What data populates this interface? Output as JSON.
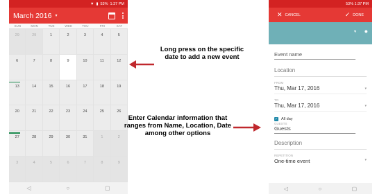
{
  "left_phone": {
    "status": {
      "battery": "53%",
      "time": "1:37 PM"
    },
    "app_bar": {
      "title": "March 2016",
      "caret": "▾"
    },
    "weekdays": [
      "SUN",
      "MON",
      "TUE",
      "WED",
      "THU",
      "FRI",
      "SAT"
    ],
    "weeks": [
      [
        "29",
        "29",
        "1",
        "2",
        "3",
        "4",
        "5"
      ],
      [
        "6",
        "7",
        "8",
        "9",
        "10",
        "11",
        "12"
      ],
      [
        "13",
        "14",
        "15",
        "16",
        "17",
        "18",
        "19"
      ],
      [
        "20",
        "21",
        "22",
        "23",
        "24",
        "25",
        "26"
      ],
      [
        "27",
        "28",
        "29",
        "30",
        "31",
        "1",
        "2"
      ],
      [
        "3",
        "4",
        "5",
        "6",
        "7",
        "8",
        "9"
      ]
    ],
    "nav": {
      "back": "◁",
      "home": "○",
      "recent": "▢"
    }
  },
  "annotations": {
    "top": "Long press on the specific date to add a new event",
    "bottom": "Enter Calendar information that ranges from Name, Location, Date among other options"
  },
  "right_phone": {
    "status": {
      "battery": "53%",
      "time": "1:37 PM"
    },
    "action_bar": {
      "cancel": "CANCEL",
      "done": "DONE",
      "cancel_glyph": "✕",
      "done_glyph": "✓"
    },
    "event_name_placeholder": "Event name",
    "location_label": "Location",
    "from_label": "FROM",
    "from_date": "Thu, Mar 17, 2016",
    "to_label": "TO",
    "to_date": "Thu, Mar 17, 2016",
    "all_day_label": "All day",
    "guests_label": "GUESTS",
    "guests_placeholder": "Guests",
    "description_label": "Description",
    "repetition_label": "REPETITION",
    "repetition_value": "One-time event",
    "nav": {
      "back": "◁",
      "home": "○",
      "recent": "▢"
    }
  },
  "colors": {
    "accent_red": "#e53935",
    "status_red": "#d32222",
    "teal": "#6fb0b7",
    "event_marker": "#1b8a4d",
    "arrow_red": "#c0282d"
  }
}
